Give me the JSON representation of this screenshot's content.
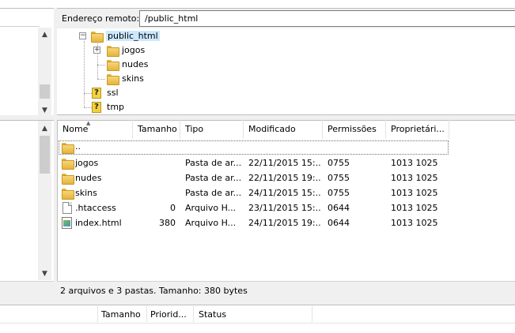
{
  "remote": {
    "label": "Endereço remoto:",
    "path": "/public_html"
  },
  "tree": [
    {
      "label": "public_html",
      "expander": "⊟"
    },
    {
      "label": "jogos",
      "expander": "⊞"
    },
    {
      "label": "nudes",
      "expander": ""
    },
    {
      "label": "skins",
      "expander": ""
    },
    {
      "label": "ssl",
      "expander": ""
    },
    {
      "label": "tmp",
      "expander": ""
    }
  ],
  "columns": {
    "name": "Nome",
    "size": "Tamanho",
    "type": "Tipo",
    "modified": "Modificado",
    "perms": "Permissões",
    "owner": "Proprietári..."
  },
  "files": [
    {
      "name": "..",
      "size": "",
      "type": "",
      "modified": "",
      "perms": "",
      "owner": "",
      "icon": "folder-icon"
    },
    {
      "name": "jogos",
      "size": "",
      "type": "Pasta de ar...",
      "modified": "22/11/2015 15:...",
      "perms": "0755",
      "owner": "1013 1025",
      "icon": "folder-icon"
    },
    {
      "name": "nudes",
      "size": "",
      "type": "Pasta de ar...",
      "modified": "22/11/2015 19:...",
      "perms": "0755",
      "owner": "1013 1025",
      "icon": "folder-icon"
    },
    {
      "name": "skins",
      "size": "",
      "type": "Pasta de ar...",
      "modified": "24/11/2015 15:...",
      "perms": "0755",
      "owner": "1013 1025",
      "icon": "folder-icon"
    },
    {
      "name": ".htaccess",
      "size": "0",
      "type": "Arquivo H...",
      "modified": "23/11/2015 15:...",
      "perms": "0644",
      "owner": "1013 1025",
      "icon": "file-icon"
    },
    {
      "name": "index.html",
      "size": "380",
      "type": "Arquivo H...",
      "modified": "24/11/2015 19:...",
      "perms": "0644",
      "owner": "1013 1025",
      "icon": "html-file-icon"
    }
  ],
  "status_text": "2 arquivos e 3 pastas. Tamanho: 380 bytes",
  "queue_columns": {
    "size": "Tamanho",
    "priority": "Priorid...",
    "status": "Status"
  }
}
